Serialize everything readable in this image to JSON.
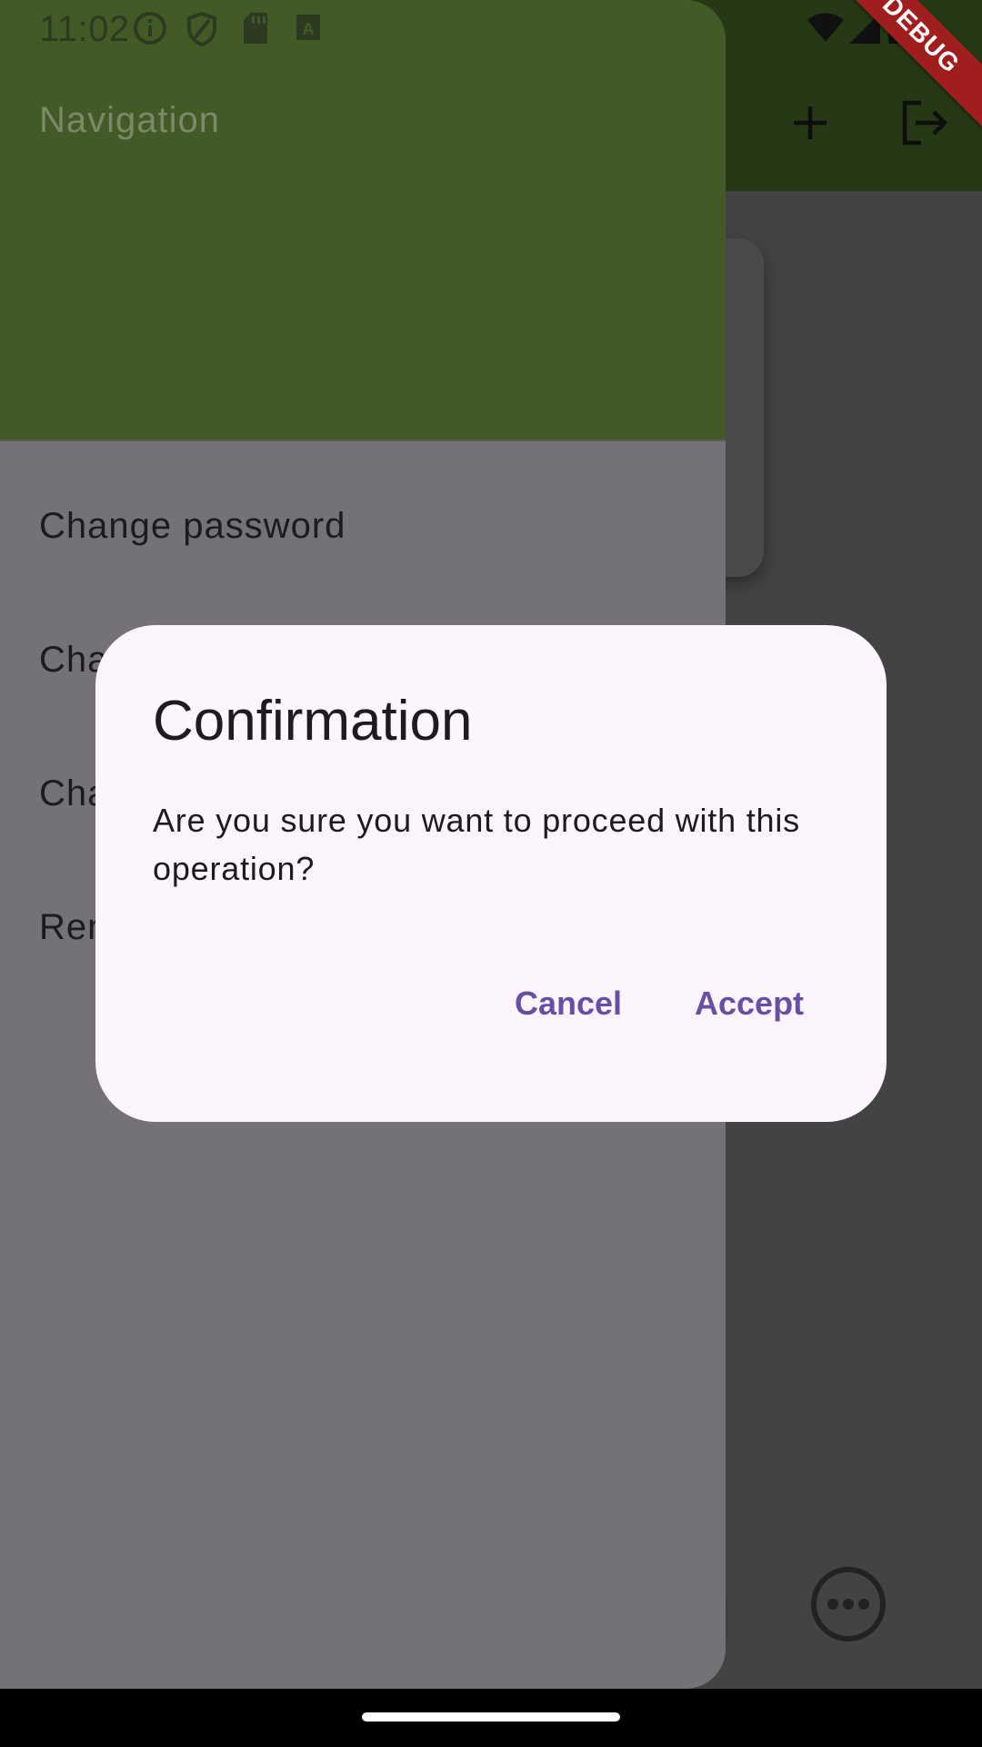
{
  "status_bar": {
    "time": "11:02",
    "icons": [
      "info-icon",
      "shield-icon",
      "sd-card-icon",
      "a-badge-icon",
      "wifi-icon",
      "signal-icon",
      "battery-icon"
    ]
  },
  "app_bar": {
    "actions": [
      "add-icon",
      "logout-icon"
    ]
  },
  "drawer": {
    "title": "Navigation",
    "items": [
      {
        "label": "Change password"
      },
      {
        "label": "Cha"
      },
      {
        "label": "Cha"
      },
      {
        "label": "Ren"
      }
    ]
  },
  "dialog": {
    "title": "Confirmation",
    "message": "Are you sure you want to proceed with this operation?",
    "cancel_label": "Cancel",
    "accept_label": "Accept"
  },
  "debug_banner": "DEBUG",
  "colors": {
    "drawer_header": "#425b26",
    "app_bar": "#253916",
    "dialog_bg": "#fdf5fd",
    "button_text": "#6750a4",
    "debug_banner": "#a11e1e"
  }
}
